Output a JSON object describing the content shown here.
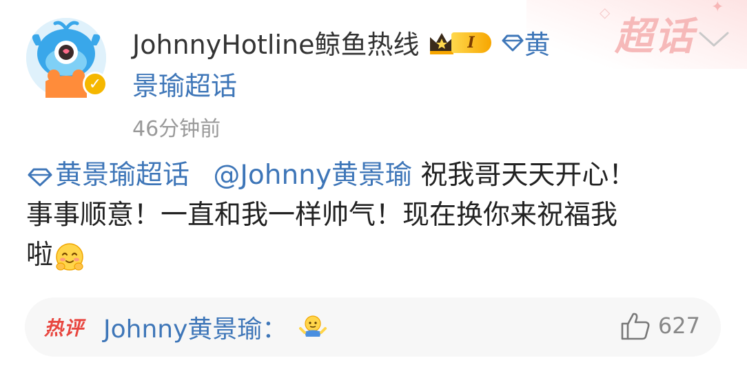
{
  "post": {
    "username": "JohnnyHotline鲸鱼热线",
    "level_badge": "I",
    "topic_name_part1": "黄",
    "topic_name_part2": "景瑜超话",
    "timestamp": "46分钟前",
    "content": {
      "topic_tag": "黄景瑜超话",
      "mention": "@Johnny黄景瑜",
      "text_line1": " 祝我哥天天开心！",
      "text_line2": "事事顺意！一直和我一样帅气！现在换你来祝福我",
      "text_line3": "啦"
    }
  },
  "decoration": {
    "text": "超话"
  },
  "hot_comment": {
    "label": "热评",
    "author": "Johnny黄景瑜",
    "separator": "：",
    "like_count": "627"
  },
  "icons": {
    "avatar": "whale-mascot-avatar",
    "verified": "verified-v-badge",
    "crown": "crown-icon",
    "topic": "diamond-topic-icon",
    "more": "chevron-down-icon",
    "face": "shy-face-emoji",
    "shrug": "shrug-emoji",
    "like": "thumbs-up-icon"
  },
  "colors": {
    "link": "#3e76b8",
    "hot": "#e8463f",
    "verified": "#f5b700",
    "muted": "#999999"
  }
}
